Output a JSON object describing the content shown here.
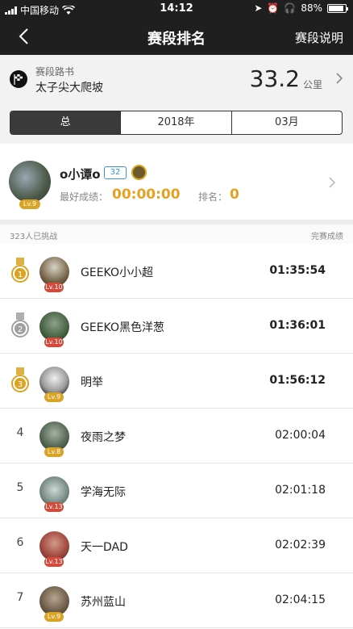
{
  "status_bar": {
    "carrier": "中国移动",
    "time": "14:12",
    "battery": "88%",
    "battery_level": 0.88
  },
  "nav": {
    "title": "赛段排名",
    "action_label": "赛段说明"
  },
  "segment": {
    "kind": "赛段路书",
    "name": "太子尖大爬坡",
    "distance": "33.2",
    "unit": "公里"
  },
  "tabs": [
    {
      "label": "总",
      "active": true
    },
    {
      "label": "2018年",
      "active": false
    },
    {
      "label": "03月",
      "active": false
    }
  ],
  "me": {
    "username": "o小谭o",
    "badge": "32",
    "level": "Lv.9",
    "best_label": "最好成绩：",
    "best_value": "00:00:00",
    "rank_label": "排名：",
    "rank_value": "0"
  },
  "list_header": {
    "participants": "323人已挑战",
    "result_label": "完赛成绩"
  },
  "colors": {
    "accent": "#e7a021",
    "gold": "#d9a323",
    "silver": "#9a9a9a",
    "nav_bg": "#1f1f1f"
  },
  "rankings": [
    {
      "rank": "1",
      "medal": "gold",
      "name": "GEEKO小小超",
      "level": "Lv.10",
      "time": "01:35:54"
    },
    {
      "rank": "2",
      "medal": "silver",
      "name": "GEEKO黑色洋葱",
      "level": "Lv.10",
      "time": "01:36:01"
    },
    {
      "rank": "3",
      "medal": "bronze",
      "name": "明举",
      "level": "Lv.9",
      "time": "01:56:12"
    },
    {
      "rank": "4",
      "medal": "",
      "name": "夜雨之梦",
      "level": "Lv.8",
      "time": "02:00:04"
    },
    {
      "rank": "5",
      "medal": "",
      "name": "学海无际",
      "level": "Lv.13",
      "time": "02:01:18"
    },
    {
      "rank": "6",
      "medal": "",
      "name": "天一DAD",
      "level": "Lv.13",
      "time": "02:02:39"
    },
    {
      "rank": "7",
      "medal": "",
      "name": "苏州蓝山",
      "level": "Lv.9",
      "time": "02:04:15"
    }
  ]
}
